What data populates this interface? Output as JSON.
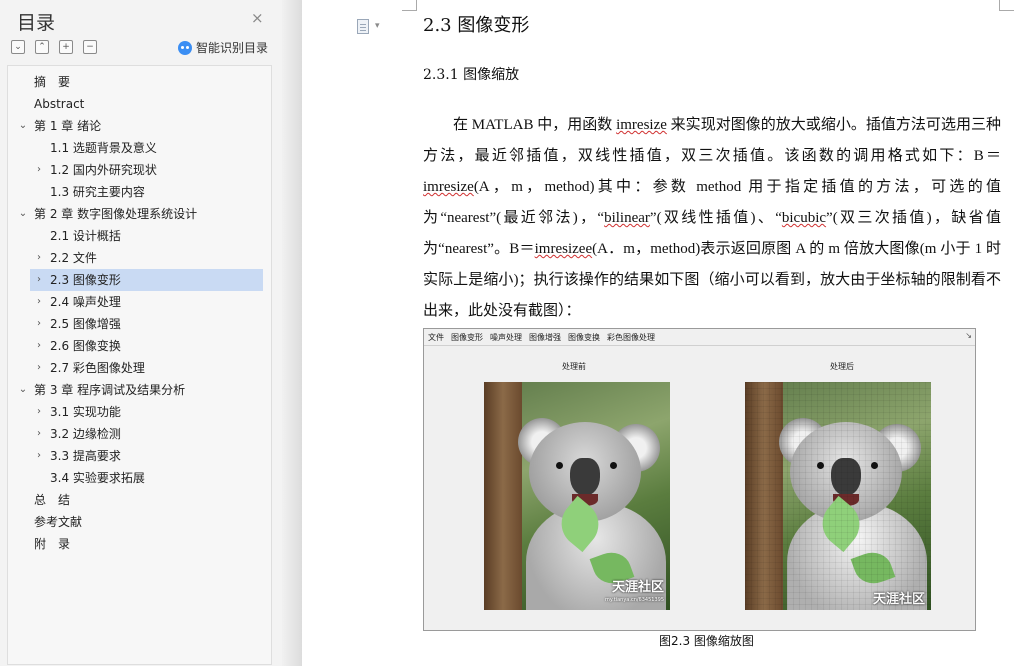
{
  "sidebar": {
    "title": "目录",
    "close_icon": "×",
    "tools": [
      "⌄",
      "⌃",
      "+",
      "−"
    ],
    "smart_toc": "智能识别目录",
    "items": [
      {
        "label": "摘　要",
        "level": 0,
        "expand": ""
      },
      {
        "label": "Abstract",
        "level": 0,
        "expand": ""
      },
      {
        "label": "第 1 章  绪论",
        "level": 0,
        "expand": "down"
      },
      {
        "label": "1.1 选题背景及意义",
        "level": 1,
        "expand": ""
      },
      {
        "label": "1.2 国内外研究现状",
        "level": 1,
        "expand": "right"
      },
      {
        "label": "1.3 研究主要内容",
        "level": 1,
        "expand": ""
      },
      {
        "label": "第 2 章  数字图像处理系统设计",
        "level": 0,
        "expand": "down"
      },
      {
        "label": "2.1 设计概括",
        "level": 1,
        "expand": ""
      },
      {
        "label": "2.2 文件",
        "level": 1,
        "expand": "right"
      },
      {
        "label": "2.3 图像变形",
        "level": 1,
        "expand": "right",
        "active": true
      },
      {
        "label": "2.4 噪声处理",
        "level": 1,
        "expand": "right"
      },
      {
        "label": "2.5 图像增强",
        "level": 1,
        "expand": "right"
      },
      {
        "label": "2.6 图像变换",
        "level": 1,
        "expand": "right"
      },
      {
        "label": "2.7 彩色图像处理",
        "level": 1,
        "expand": "right"
      },
      {
        "label": "第 3 章  程序调试及结果分析",
        "level": 0,
        "expand": "down"
      },
      {
        "label": "3.1 实现功能",
        "level": 1,
        "expand": "right"
      },
      {
        "label": "3.2 边缘检测",
        "level": 1,
        "expand": "right"
      },
      {
        "label": "3.3 提高要求",
        "level": 1,
        "expand": "right"
      },
      {
        "label": "3.4 实验要求拓展",
        "level": 1,
        "expand": ""
      },
      {
        "label": "总　结",
        "level": 0,
        "expand": ""
      },
      {
        "label": "参考文献",
        "level": 0,
        "expand": ""
      },
      {
        "label": "附　录",
        "level": 0,
        "expand": ""
      }
    ]
  },
  "document": {
    "heading2": "2.3 图像变形",
    "heading3": "2.3.1 图像缩放",
    "para": [
      "在 MATLAB 中，用函数 ",
      "imresize",
      " 来实现对图像的放大或缩小。插值方法可选用三种方法，最近邻插值，双线性插值，双三次插值。该函数的调用格式如下：B＝",
      "imresize",
      "(A，m，method)其中：参数 method 用于指定插值的方法，可选的值为“nearest”(最近邻法)，“",
      "bilinear",
      "”(双线性插值)、“",
      "bicubic",
      "”(双三次插值)，缺省值为“nearest”。B＝",
      "imresizee",
      "(A．m，method)表示返回原图 A 的 m 倍放大图像(m 小于 1 时实际上是缩小)；执行该操作的结果如下图（缩小可以看到，放大由于坐标轴的限制看不出来，此处没有截图）："
    ],
    "figure": {
      "menu": [
        "文件",
        "图像变形",
        "噪声处理",
        "图像增强",
        "图像变换",
        "彩色图像处理"
      ],
      "arrow": "↘",
      "label_before": "处理前",
      "label_after": "处理后",
      "watermark": "天涯社区",
      "watermark_url": "my.tianya.cn/63451395"
    },
    "caption": "图2.3  图像缩放图"
  }
}
